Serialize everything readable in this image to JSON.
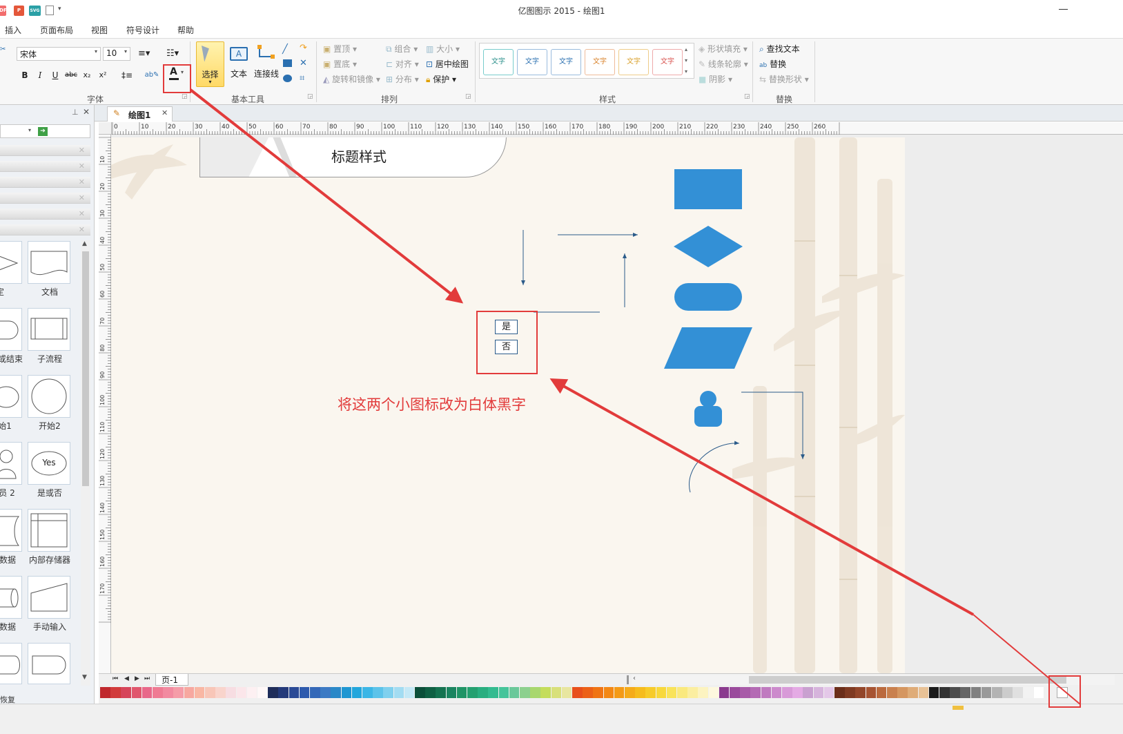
{
  "window": {
    "title": "亿图图示 2015 - 绘图1"
  },
  "qat": [
    {
      "icon": "pdf-export-icon",
      "label": "PDF",
      "color": "#f26d6d"
    },
    {
      "icon": "ppt-export-icon",
      "label": "P",
      "color": "#e4573a"
    },
    {
      "icon": "svg-export-icon",
      "label": "SVG",
      "color": "#2aa0a6"
    }
  ],
  "menu": [
    "插入",
    "页面布局",
    "视图",
    "符号设计",
    "帮助"
  ],
  "ribbon": {
    "font": {
      "family": "宋体",
      "size": "10",
      "group_label": "字体"
    },
    "tools": {
      "select": "选择",
      "text": "文本",
      "connector": "连接线",
      "group_label": "基本工具"
    },
    "arrange": {
      "front": "置顶",
      "back": "置底",
      "rotate": "旋转和镜像",
      "group": "组合",
      "align": "对齐",
      "distribute": "分布",
      "size": "大小",
      "center": "居中绘图",
      "protect": "保护",
      "group_label": "排列"
    },
    "styles": {
      "samples": [
        "文字",
        "文字",
        "文字",
        "文字",
        "文字",
        "文字"
      ],
      "colors": [
        "#2a8f8a",
        "#2a6fb0",
        "#2a6fb0",
        "#d9822b",
        "#d9a02b",
        "#d9534f"
      ],
      "fill": "形状填充",
      "line": "线条轮廓",
      "shadow": "阴影",
      "group_label": "样式"
    },
    "replace": {
      "find": "查找文本",
      "replace": "替换",
      "replace_shape": "替换形状",
      "group_label": "替换"
    }
  },
  "library": {
    "shapes": [
      {
        "left": "定",
        "right": "文档"
      },
      {
        "left": "或结束",
        "right": "子流程"
      },
      {
        "left": "始1",
        "right": "开始2"
      },
      {
        "left": "员 2",
        "right": "是或否"
      },
      {
        "left": "数据",
        "right": "内部存储器"
      },
      {
        "left": "数据",
        "right": "手动输入"
      }
    ],
    "yes_text": "Yes"
  },
  "document": {
    "tab": "绘图1",
    "ruler_labels": [
      "0",
      "10",
      "20",
      "30",
      "40",
      "50",
      "60",
      "70",
      "80",
      "90",
      "100",
      "110",
      "120",
      "130",
      "140",
      "150",
      "160",
      "170",
      "180",
      "190",
      "200",
      "210",
      "220",
      "230",
      "240",
      "250",
      "260"
    ],
    "vruler_labels": [
      "10",
      "20",
      "30",
      "40",
      "50",
      "60",
      "70",
      "80",
      "90",
      "100",
      "110",
      "120",
      "130",
      "140",
      "150",
      "160",
      "170"
    ],
    "title_shape": "标题样式",
    "yes_label": "是",
    "no_label": "否",
    "annotation": "将这两个小图标改为白体黑字",
    "page_tab": "页-1"
  },
  "status": {
    "restore": "恢复"
  },
  "palette": [
    "#c0282d",
    "#d13b3b",
    "#d6455a",
    "#e0566d",
    "#e8688a",
    "#ef7a93",
    "#f28aa0",
    "#f59ca8",
    "#f7a8a0",
    "#f9b7a4",
    "#f8c6b8",
    "#f9d4cc",
    "#f7dde2",
    "#fbe6ea",
    "#fdf0f2",
    "#fff8f8",
    "#1f2d5a",
    "#243a7a",
    "#2a4a96",
    "#2e5aad",
    "#3468b8",
    "#3c7ac4",
    "#2a88c8",
    "#1e96d2",
    "#22a6dc",
    "#3bb6e6",
    "#5cc3ea",
    "#7fd0ee",
    "#a2dcf2",
    "#c4e8f6",
    "#0b4f3a",
    "#0f6044",
    "#147250",
    "#1a8460",
    "#1f9466",
    "#24a070",
    "#29ae80",
    "#33bb90",
    "#45c49a",
    "#6ac89a",
    "#8cd08e",
    "#a8d76e",
    "#c4dd5c",
    "#d8e07a",
    "#e8e6a0",
    "#e8501c",
    "#ec6118",
    "#f07414",
    "#f38714",
    "#f49a16",
    "#f5ab1a",
    "#f6bc1e",
    "#f7cb2a",
    "#f8d83c",
    "#f9e35a",
    "#fae97e",
    "#fbeea0",
    "#fcf3c0",
    "#fdf8de",
    "#8a3a8e",
    "#9a4a9c",
    "#a85aa8",
    "#b46ab4",
    "#c07ac0",
    "#cc8acc",
    "#d89ad8",
    "#e4aae4",
    "#c9a0d0",
    "#d6b4dc",
    "#e4c8e8",
    "#6b2e1a",
    "#7f3a22",
    "#93462a",
    "#a75432",
    "#bb6a3e",
    "#c9804e",
    "#d59660",
    "#dfac78",
    "#e8c296",
    "#1a1a1a",
    "#333333",
    "#4d4d4d",
    "#666666",
    "#808080",
    "#999999",
    "#b3b3b3",
    "#cccccc",
    "#e0e0e0",
    "#f2f2f2",
    "#ffffff"
  ]
}
